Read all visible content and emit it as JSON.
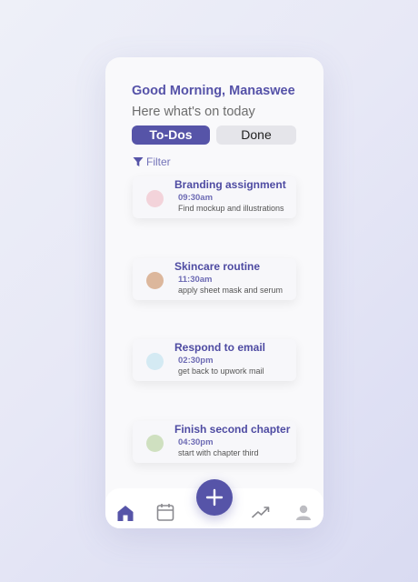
{
  "header": {
    "greeting": "Good Morning, Manaswee",
    "subtitle": "Here what's on today"
  },
  "tabs": [
    {
      "label": "To-Dos",
      "active": true
    },
    {
      "label": "Done",
      "active": false
    }
  ],
  "filter": {
    "label": "Filter",
    "icon": "filter-icon"
  },
  "tasks": [
    {
      "title": "Branding assignment",
      "time": "09:30am",
      "description": "Find mockup and illustrations",
      "color": "#f3d3da"
    },
    {
      "title": "Skincare routine",
      "time": "11:30am",
      "description": "apply sheet mask and serum",
      "color": "#dcb79c"
    },
    {
      "title": "Respond to email",
      "time": "02:30pm",
      "description": "get back to upwork mail",
      "color": "#d4eaf3"
    },
    {
      "title": "Finish second chapter",
      "time": "04:30pm",
      "description": "start with chapter third",
      "color": "#cfe0c0"
    }
  ],
  "nav": {
    "items": [
      {
        "name": "home-icon",
        "active": true
      },
      {
        "name": "calendar-icon",
        "active": false
      },
      {
        "name": "add-icon",
        "active": false
      },
      {
        "name": "trending-icon",
        "active": false
      },
      {
        "name": "profile-icon",
        "active": false
      }
    ]
  },
  "colors": {
    "accent": "#5654a8",
    "inactive_icon": "#8a8a8f"
  }
}
